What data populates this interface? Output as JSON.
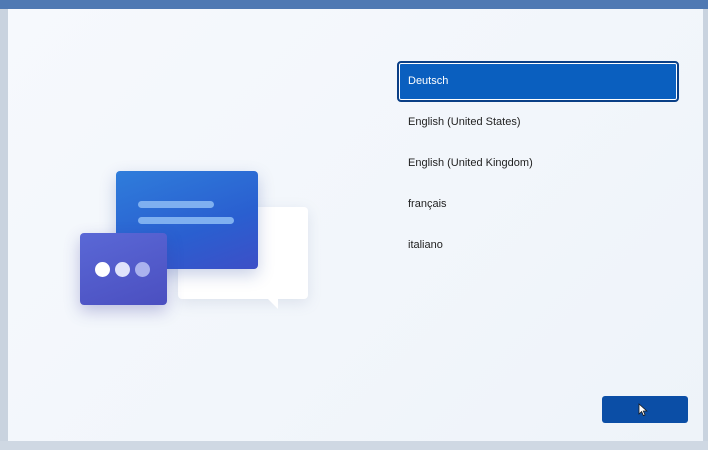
{
  "languages": {
    "items": [
      {
        "label": "Deutsch",
        "selected": true
      },
      {
        "label": "English (United States)",
        "selected": false
      },
      {
        "label": "English (United Kingdom)",
        "selected": false
      },
      {
        "label": "français",
        "selected": false
      },
      {
        "label": "italiano",
        "selected": false
      }
    ]
  },
  "illustration": {
    "icon": "chat-bubbles-icon",
    "colors": {
      "blue_card": "#2a5fd0",
      "purple_card": "#4b4fc0",
      "back_bubble": "#ffffff"
    }
  },
  "next_button": {
    "label": "",
    "color": "#0b4ea6"
  },
  "colors": {
    "accent": "#0a5fbf",
    "frame": "#4f79b3"
  }
}
